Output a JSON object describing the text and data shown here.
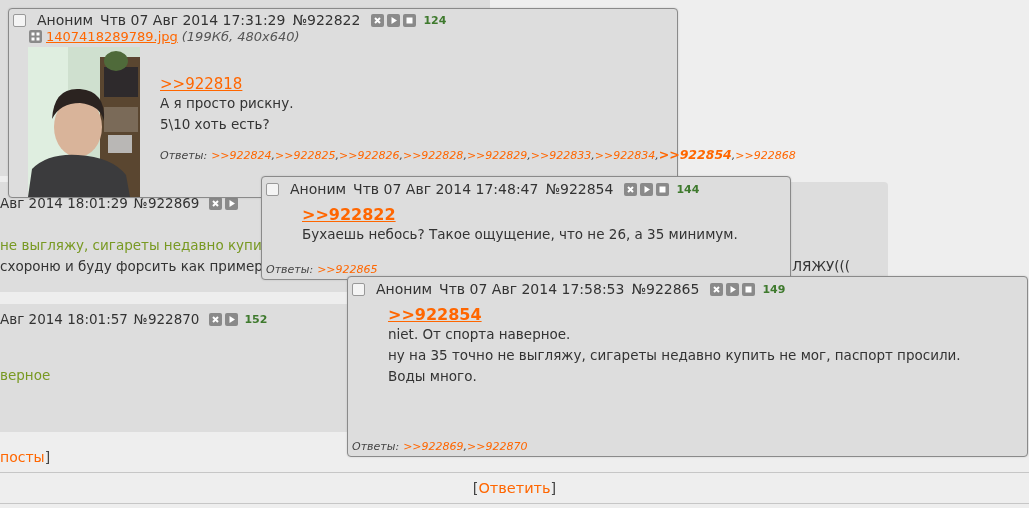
{
  "thread": {
    "posts": [
      {
        "date": "Авг 2014 18:01:29",
        "number": "№922869",
        "buttons": [
          {
            "kind": "hide"
          },
          {
            "kind": "play"
          }
        ],
        "lines": [
          {
            "kind": "quote",
            "text": "не выгляжу, сигареты недавно купи"
          },
          {
            "kind": "plain",
            "text": "схороню и буду форсить как пример"
          }
        ],
        "tail": "ЛЯЖУ((("
      },
      {
        "date": "Авг 2014 18:01:57",
        "number": "№922870",
        "buttons": [
          {
            "kind": "hide"
          },
          {
            "kind": "play"
          }
        ],
        "rating": "152",
        "lines": [
          {
            "kind": "quote",
            "text": "верное"
          }
        ]
      }
    ],
    "more": {
      "label": "посты",
      "close": "]"
    },
    "reply": {
      "open": "[",
      "label": "Ответить",
      "close": "]"
    }
  },
  "popups": [
    {
      "checked": false,
      "author": "Аноним",
      "date": "Чтв 07 Авг 2014 17:31:29",
      "number": "№922822",
      "buttons": [
        {
          "kind": "hide"
        },
        {
          "kind": "play"
        },
        {
          "kind": "stop"
        }
      ],
      "rating": "124",
      "file": {
        "name": "1407418289789.jpg",
        "info": "(199Кб, 480x640)"
      },
      "image": {
        "kind": "picture"
      },
      "ref": {
        "text": ">>922818",
        "bold": false
      },
      "lines": [
        "А я просто рискну.",
        "5\\10 хоть есть?"
      ],
      "replies_label": "Ответы:",
      "replies": [
        {
          "text": ">>922824",
          "bold": false,
          "sep": ","
        },
        {
          "text": ">>922825",
          "bold": false,
          "sep": ","
        },
        {
          "text": ">>922826",
          "bold": false,
          "sep": ","
        },
        {
          "text": ">>922828",
          "bold": false,
          "sep": ","
        },
        {
          "text": ">>922829",
          "bold": false,
          "sep": ","
        },
        {
          "text": ">>922833",
          "bold": false,
          "sep": ","
        },
        {
          "text": ">>922834",
          "bold": false,
          "sep": ","
        },
        {
          "text": ">>922854",
          "bold": true,
          "sep": ","
        },
        {
          "text": ">>922868",
          "bold": false
        }
      ]
    },
    {
      "checked": false,
      "author": "Аноним",
      "date": "Чтв 07 Авг 2014 17:48:47",
      "number": "№922854",
      "buttons": [
        {
          "kind": "hide"
        },
        {
          "kind": "play"
        },
        {
          "kind": "stop"
        }
      ],
      "rating": "144",
      "ref": {
        "text": ">>922822",
        "bold": true
      },
      "lines": [
        "Бухаешь небось? Такое ощущение, что не 26, а 35 минимум."
      ],
      "replies_label": "Ответы:",
      "replies": [
        {
          "text": ">>922865",
          "bold": false
        }
      ]
    },
    {
      "checked": false,
      "author": "Аноним",
      "date": "Чтв 07 Авг 2014 17:58:53",
      "number": "№922865",
      "buttons": [
        {
          "kind": "hide"
        },
        {
          "kind": "play"
        },
        {
          "kind": "stop"
        }
      ],
      "rating": "149",
      "ref": {
        "text": ">>922854",
        "bold": true
      },
      "lines": [
        "niet. От спорта наверное.",
        "ну на 35 точно не выгляжу, сигареты недавно купить не мог, паспорт просили.",
        "Воды много."
      ],
      "replies_label": "Ответы:",
      "replies": [
        {
          "text": ">>922869",
          "bold": false,
          "sep": ","
        },
        {
          "text": ">>922870",
          "bold": false
        }
      ]
    }
  ]
}
